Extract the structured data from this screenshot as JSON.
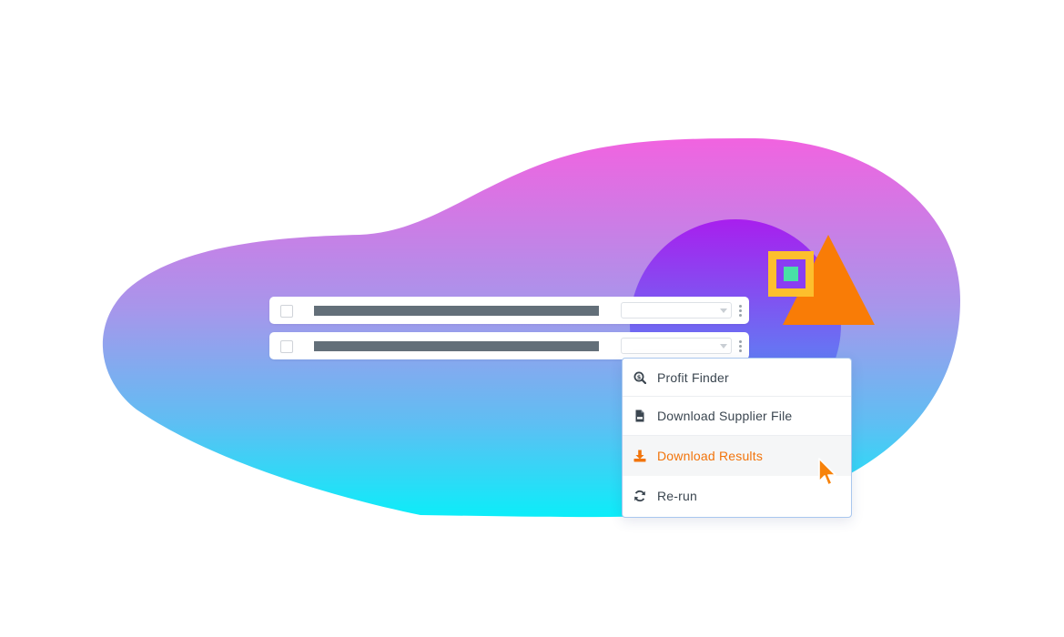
{
  "colors": {
    "blob_top": "#f163e0",
    "blob_mid": "#a796eb",
    "blob_bottom": "#0cedf9",
    "circle_top": "#a81fee",
    "circle_bottom": "#3fa8f6",
    "square_outer": "#fdbf2d",
    "square_inner": "#8a3df2",
    "square_core": "#48e0a6",
    "triangle": "#f97c06",
    "accent": "#f2740b",
    "menu_border": "#a9c7ee"
  },
  "rows": [
    {
      "id": "row-1"
    },
    {
      "id": "row-2"
    }
  ],
  "menu": {
    "items": [
      {
        "label": "Profit Finder",
        "icon": "search-dollar-icon"
      },
      {
        "label": "Download Supplier File",
        "icon": "csv-file-icon"
      },
      {
        "label": "Download Results",
        "icon": "download-icon",
        "active": true
      },
      {
        "label": "Re-run",
        "icon": "refresh-icon"
      }
    ]
  }
}
